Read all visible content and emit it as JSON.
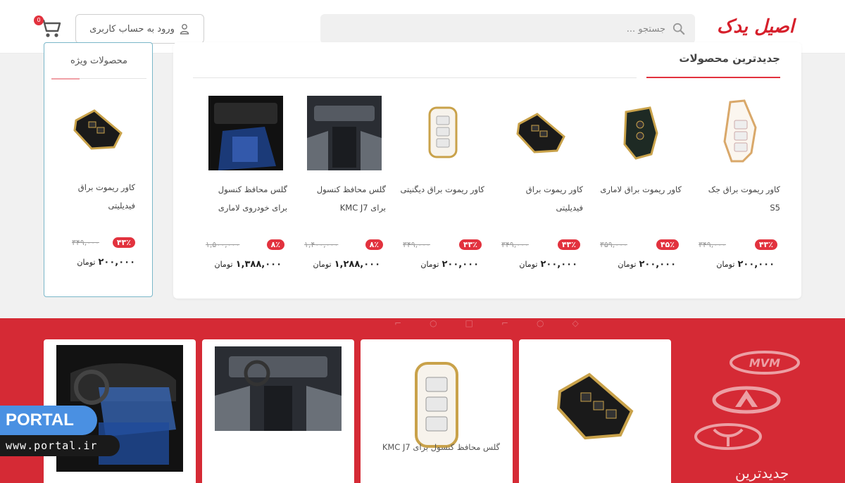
{
  "header": {
    "logo_text": "اصیل یدک",
    "search_placeholder": "جستجو ...",
    "login_label": "ورود به حساب کاربری",
    "cart_count": "0"
  },
  "newest": {
    "title": "جدیدترین محصولات",
    "products": [
      {
        "name": "کاور ریموت براق جک S5",
        "old_price": "۳۴۹,۰۰۰",
        "discount": "۴۳٪",
        "new_price": "۲۰۰,۰۰۰",
        "currency": "تومان"
      },
      {
        "name": "کاور ریموت براق لاماری",
        "old_price": "۳۵۹,۰۰۰",
        "discount": "۴۵٪",
        "new_price": "۲۰۰,۰۰۰",
        "currency": "تومان"
      },
      {
        "name": "کاور ریموت براق فیدیلیتی",
        "old_price": "۳۴۹,۰۰۰",
        "discount": "۴۳٪",
        "new_price": "۲۰۰,۰۰۰",
        "currency": "تومان"
      },
      {
        "name": "کاور ریموت براق دیگنیتی",
        "old_price": "۳۴۹,۰۰۰",
        "discount": "۴۳٪",
        "new_price": "۲۰۰,۰۰۰",
        "currency": "تومان"
      },
      {
        "name": "گلس محافظ کنسول برای KMC J7",
        "old_price": "۱,۴۰۰,۰۰۰",
        "discount": "۸٪",
        "new_price": "۱,۲۸۸,۰۰۰",
        "currency": "تومان"
      },
      {
        "name": "گلس محافظ کنسول برای خودروی لاماری",
        "old_price": "۱,۵۰۰,۰۰۰",
        "discount": "۸٪",
        "new_price": "۱,۳۸۸,۰۰۰",
        "currency": "تومان"
      }
    ]
  },
  "special": {
    "title": "محصولات ویژه",
    "product": {
      "name": "کاور ریموت براق فیدیلیتی",
      "old_price": "۳۴۹,۰۰۰",
      "discount": "۴۳٪",
      "new_price": "۲۰۰,۰۰۰",
      "currency": "تومان"
    }
  },
  "banner": {
    "cards": [
      {
        "name": ""
      },
      {
        "name": ""
      },
      {
        "name": "گلس محافظ کنسول برای KMC J7"
      },
      {
        "name": ""
      }
    ],
    "brands": [
      "MVM",
      "Chery",
      "Lamari"
    ],
    "text": "جدیدترین"
  },
  "watermark": {
    "brand": "PORTAL",
    "url": "www.portal.ir"
  },
  "colors": {
    "accent": "#e2323e",
    "banner": "#d52a35",
    "special_border": "#7ab7c9",
    "watermark_blue": "#4a90e2"
  }
}
